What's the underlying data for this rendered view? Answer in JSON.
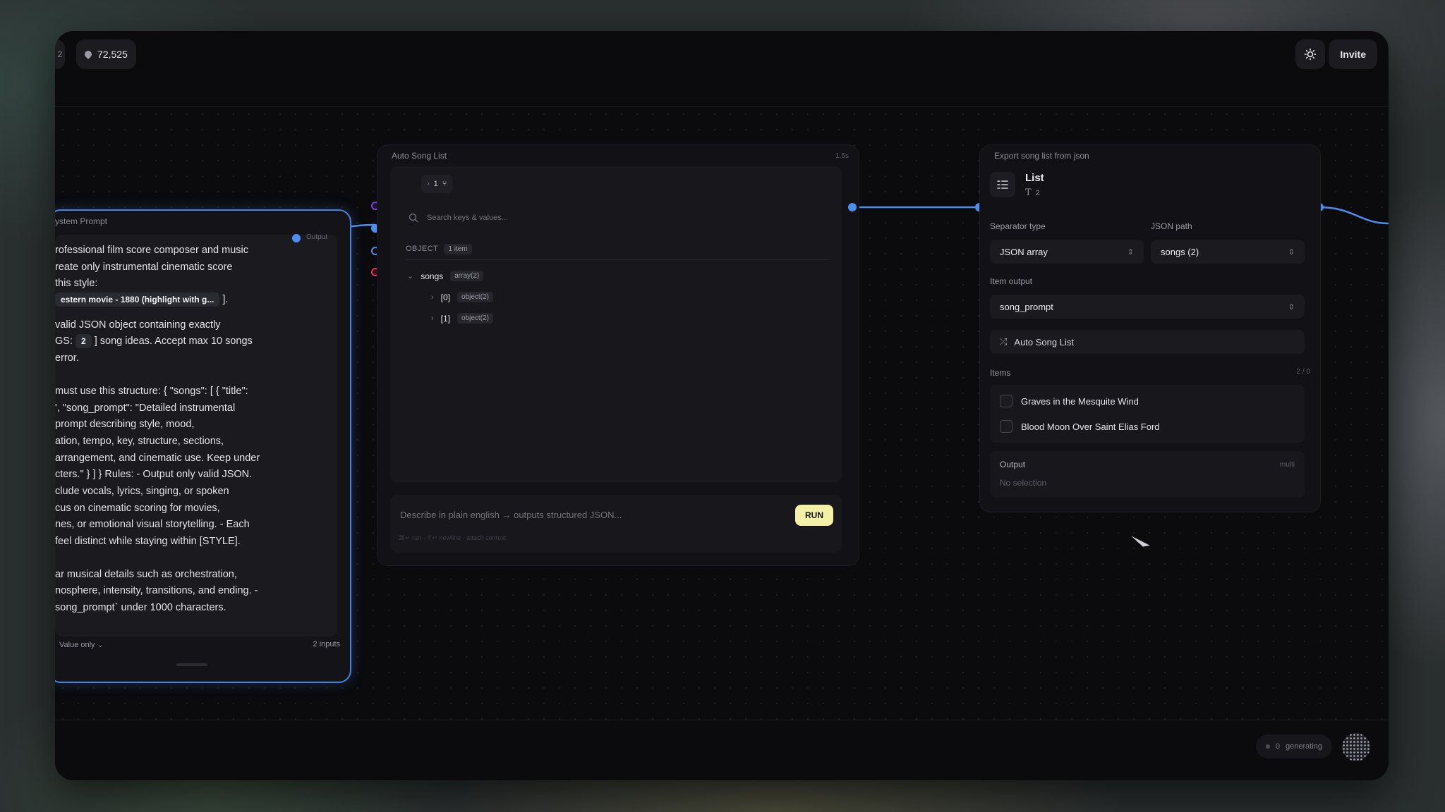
{
  "topbar": {
    "stub_label": "2",
    "credits": "72,525",
    "invite_label": "Invite"
  },
  "system_prompt": {
    "title": "ystem Prompt",
    "output_label": "Output",
    "lines": [
      "rofessional film score composer and music",
      "reate only instrumental cinematic score",
      " this style:",
      "",
      "",
      "valid JSON object containing exactly",
      "",
      "error.",
      "must use this structure: { \"songs\": [ { \"title\":",
      "', \"song_prompt\": \"Detailed instrumental",
      "prompt describing style, mood,",
      "ation, tempo, key, structure, sections,",
      "arrangement, and cinematic use. Keep under",
      "cters.\" } ] } Rules: - Output only valid JSON.",
      "clude vocals, lyrics, singing, or spoken",
      "cus on cinematic scoring for movies,",
      "nes, or emotional visual storytelling. - Each",
      "feel distinct while staying within [STYLE].",
      "ar musical details such as orchestration,",
      "nosphere, intensity, transitions, and ending. -",
      "song_prompt` under 1000 characters."
    ],
    "style_chip": "estern movie - 1880 (highlight with g...",
    "style_chip_close": "].",
    "count_prefix": "GS:",
    "count_chip": "2",
    "count_suffix": "] song ideas. Accept max 10 songs",
    "mode": "Value only",
    "inputs": "2 inputs"
  },
  "auto_song_list": {
    "title": "Auto Song List",
    "duration": "1.5s",
    "branch_count": "1",
    "search_placeholder": "Search keys & values...",
    "object_label": "OBJECT",
    "object_count": "1 item",
    "tree": {
      "root_key": "songs",
      "root_type": "array(2)",
      "children": [
        {
          "key": "[0]",
          "type": "object(2)"
        },
        {
          "key": "[1]",
          "type": "object(2)"
        }
      ]
    },
    "prompt_placeholder": "Describe in plain english → outputs structured JSON...",
    "hint": "⌘↵ run · ⇧↵ newline · attach context",
    "run_label": "RUN"
  },
  "export": {
    "title": "Export song list from json",
    "node_type": "List",
    "node_meta": "2",
    "separator_label": "Separator type",
    "separator_value": "JSON array",
    "json_path_label": "JSON path",
    "json_path_value": "songs (2)",
    "item_output_label": "Item output",
    "item_output_value": "song_prompt",
    "source": "Auto Song List",
    "items_label": "Items",
    "items_count": "2 / 0",
    "items": [
      "Graves in the Mesquite Wind",
      "Blood Moon Over Saint Elias Ford"
    ],
    "output_label": "Output",
    "output_mode": "multi",
    "output_value": "No selection"
  },
  "status": {
    "generating_count": "0",
    "generating_label": "generating"
  },
  "colors": {
    "accent": "#4d8ef0",
    "run_button": "#f4f1a6",
    "danger_port": "#e03060",
    "purple_port": "#7a3fd6"
  }
}
